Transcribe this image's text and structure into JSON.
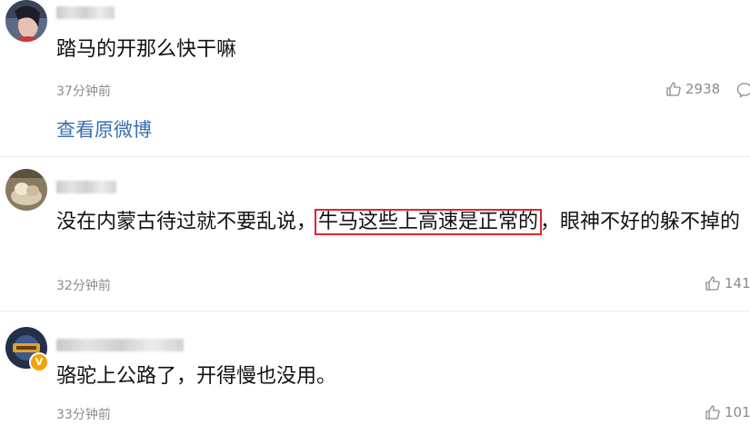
{
  "comments": [
    {
      "text": "踏马的开那么快干嘛",
      "time": "37分钟前",
      "likes": "2938",
      "view_original": "查看原微博"
    },
    {
      "text_before": "没在内蒙古待过就不要乱说，",
      "text_highlight": "牛马这些上高速是正常的",
      "text_after": "，眼神不好的躲不掉的",
      "time": "32分钟前",
      "likes": "141"
    },
    {
      "text": "骆驼上公路了，开得慢也没用。",
      "time": "33分钟前",
      "likes": "101",
      "verified_badge": "V"
    }
  ],
  "icons": {
    "like": "thumb-up-icon",
    "reply": "comment-icon"
  },
  "colors": {
    "link": "#3a6fb3",
    "highlight_border": "#e0262e",
    "meta_gray": "#8c8c8c",
    "badge": "#f2a400"
  }
}
